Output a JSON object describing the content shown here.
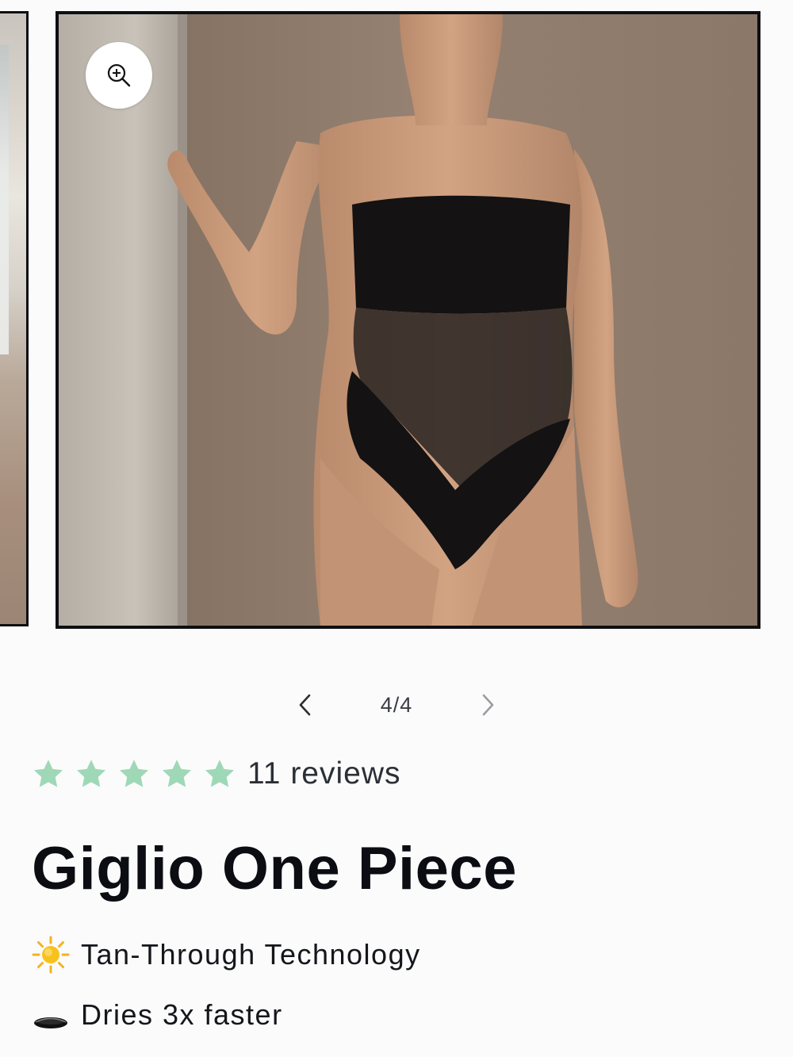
{
  "gallery": {
    "current_page": 4,
    "total_pages": 4,
    "counter_text": "4/4",
    "zoom_icon": "zoom-in-icon",
    "prev_icon": "chevron-left-icon",
    "next_icon": "chevron-right-icon"
  },
  "rating": {
    "stars": 5,
    "star_color": "#9fd8b7",
    "reviews_text": "11 reviews"
  },
  "product": {
    "title": "Giglio One Piece"
  },
  "features": [
    {
      "icon": "sun-icon",
      "text": "Tan-Through Technology"
    },
    {
      "icon": "hole-icon",
      "text": "Dries 3x faster"
    }
  ]
}
